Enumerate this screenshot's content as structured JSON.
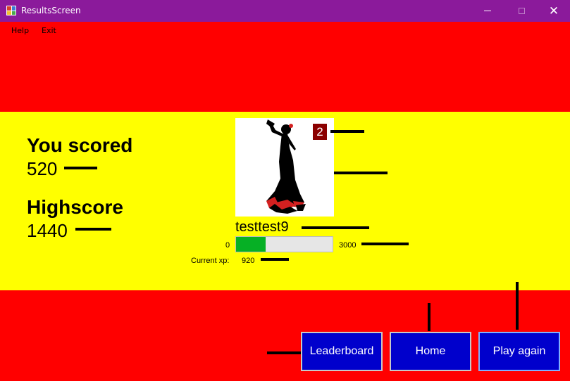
{
  "window": {
    "title": "ResultsScreen",
    "minimize_icon": "minimize-icon",
    "maximize_icon": "maximize-icon",
    "close_glyph": "✕"
  },
  "menu": {
    "items": [
      "Help",
      "Exit"
    ]
  },
  "score": {
    "label": "You scored",
    "value": "520"
  },
  "highscore": {
    "label": "Highscore",
    "value": "1440"
  },
  "player": {
    "avatar_icon": "flamenco-dancer-icon",
    "level": "2",
    "username": "testtest9"
  },
  "xp": {
    "min": "0",
    "max": "3000",
    "current_label": "Current xp:",
    "current": "920",
    "progress_fraction": 0.3067
  },
  "buttons": {
    "leaderboard": "Leaderboard",
    "home": "Home",
    "play_again": "Play again"
  },
  "colors": {
    "titlebar": "#8b1a9b",
    "band_red": "#ff0000",
    "band_yellow": "#ffff00",
    "button": "#0000cc",
    "level_badge": "#8b0000",
    "xp_fill": "#06b025"
  }
}
